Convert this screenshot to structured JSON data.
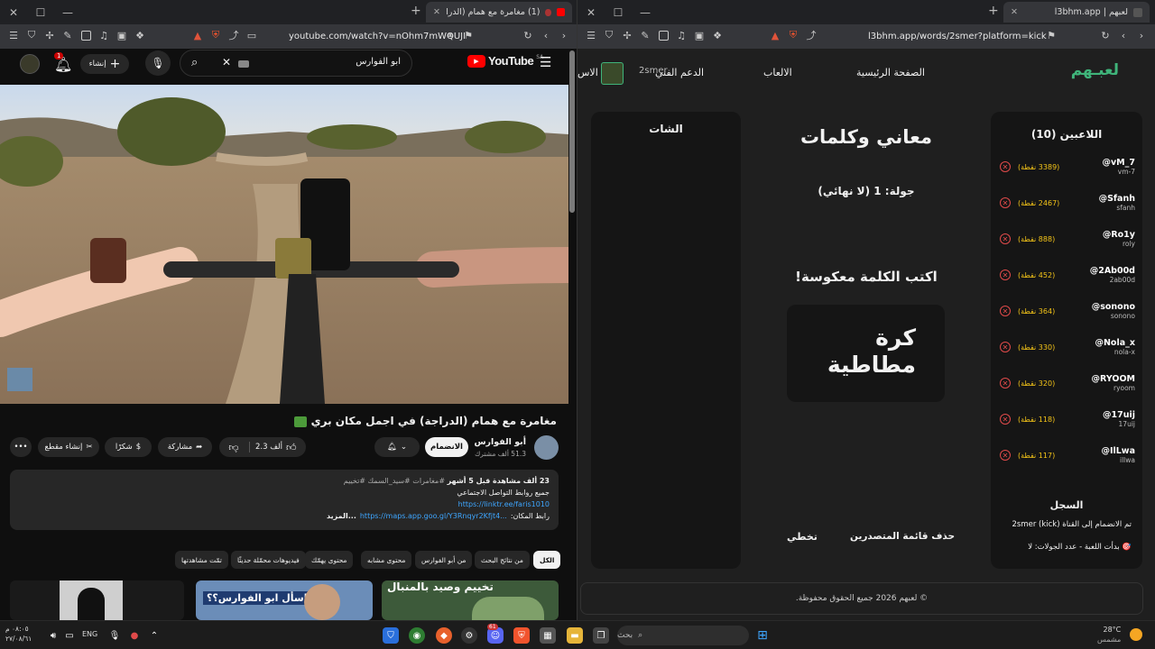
{
  "left_window": {
    "tab_title": "(1) مغامرة مع همام (الدراجة) في",
    "new_tab": "+",
    "url": "youtube.com/watch?v=nOhm7mWQUJI",
    "win_min": "—",
    "win_max": "☐",
    "win_close": "✕"
  },
  "youtube": {
    "logo_text": "YouTube",
    "region": "SA",
    "search_value": "ابو الفوارس",
    "create_label": "إنشاء",
    "notif_count": "1",
    "video_title": "مغامرة مع همام (الدراجة) في اجمل مكان بري",
    "channel_name": "أبو الفوارس",
    "subscribers": "51.3 ألف مشترك",
    "subscribe_label": "الانضمام",
    "likes": "2.3 ألف",
    "share_label": "مشاركة",
    "thanks_label": "شكرًا",
    "clip_label": "إنشاء مقطع",
    "desc_meta": "23 ألف مشاهدة قبل 5 أشهر",
    "desc_tags": "#مغامرات #سيد_السمك #تخييم",
    "desc_line1": "جميع روابط التواصل الاجتماعي",
    "desc_link1": "https://linktr.ee/faris1010",
    "desc_line3_prefix": "رابط المكان:",
    "desc_link2": "https://maps.app.goo.gl/Y3Rnqyr2Kfjt4...",
    "desc_more": "...المزيد",
    "chips": [
      "الكل",
      "من نتائج البحث",
      "من أبو الفوارس",
      "محتوى مشابه",
      "محتوى يهمّك",
      "فيديوهات محمّلة حديثًا",
      "تمّت مشاهدتها"
    ],
    "thumb1_text": "تخييم وصيد بالمنبال",
    "thumb2_text": "اسأل ابو الفوارس؟؟"
  },
  "right_window": {
    "tab_title": "لعبهم | l3bhm.app",
    "url": "l3bhm.app/words/2smer?platform=kick",
    "new_tab": "+"
  },
  "site": {
    "logo": "لعبـهم",
    "nav_home": "الصفحة الرئيسية",
    "nav_games": "الالعاب",
    "nav_support": "الدعم الفني",
    "nav_user": "2smer",
    "nav_more": "الاس",
    "players_title": "اللاعبين (10)",
    "players": [
      {
        "name": "@vM_7",
        "user": "vm-7",
        "points": "(3389 نقطة)"
      },
      {
        "name": "@Sfanh",
        "user": "sfanh",
        "points": "(2467 نقطة)"
      },
      {
        "name": "@Ro1y",
        "user": "roly",
        "points": "(888 نقطة)"
      },
      {
        "name": "@2Ab00d",
        "user": "2ab00d",
        "points": "(452 نقطة)"
      },
      {
        "name": "@sonono",
        "user": "sonono",
        "points": "(364 نقطة)"
      },
      {
        "name": "@Nola_x",
        "user": "nola-x",
        "points": "(330 نقطة)"
      },
      {
        "name": "@RYOOM",
        "user": "ryoom",
        "points": "(320 نقطة)"
      },
      {
        "name": "@17uij",
        "user": "17uij",
        "points": "(118 نقطة)"
      },
      {
        "name": "@IlLwa",
        "user": "illwa",
        "points": "(117 نقطة)"
      }
    ],
    "game_title": "معاني وكلمات",
    "round_text": "جولة: 1 (لا نهائي)",
    "instruction": "اكتب الكلمة معكوسة!",
    "word_line1": "كرة",
    "word_line2": "مطاطية",
    "clear_board": "حذف قائمة المتصدرين",
    "skip": "تخطي",
    "chat_title": "الشات",
    "log_title": "السجل",
    "log_line1": "تم الانضمام إلى القناة 2smer (kick)",
    "log_line2": "🎯 بدأت اللعبة - عدد الجولات: لا",
    "footer": "© لعبهم 2026 جميع الحقوق محفوظة."
  },
  "taskbar": {
    "time": "٠٨:٠٥ م",
    "date": "٢٧/٠٨/٦١",
    "lang": "ENG",
    "search_placeholder": "بحث",
    "weather_temp": "28°C",
    "weather_desc": "مشمس",
    "badge_count": "61"
  }
}
